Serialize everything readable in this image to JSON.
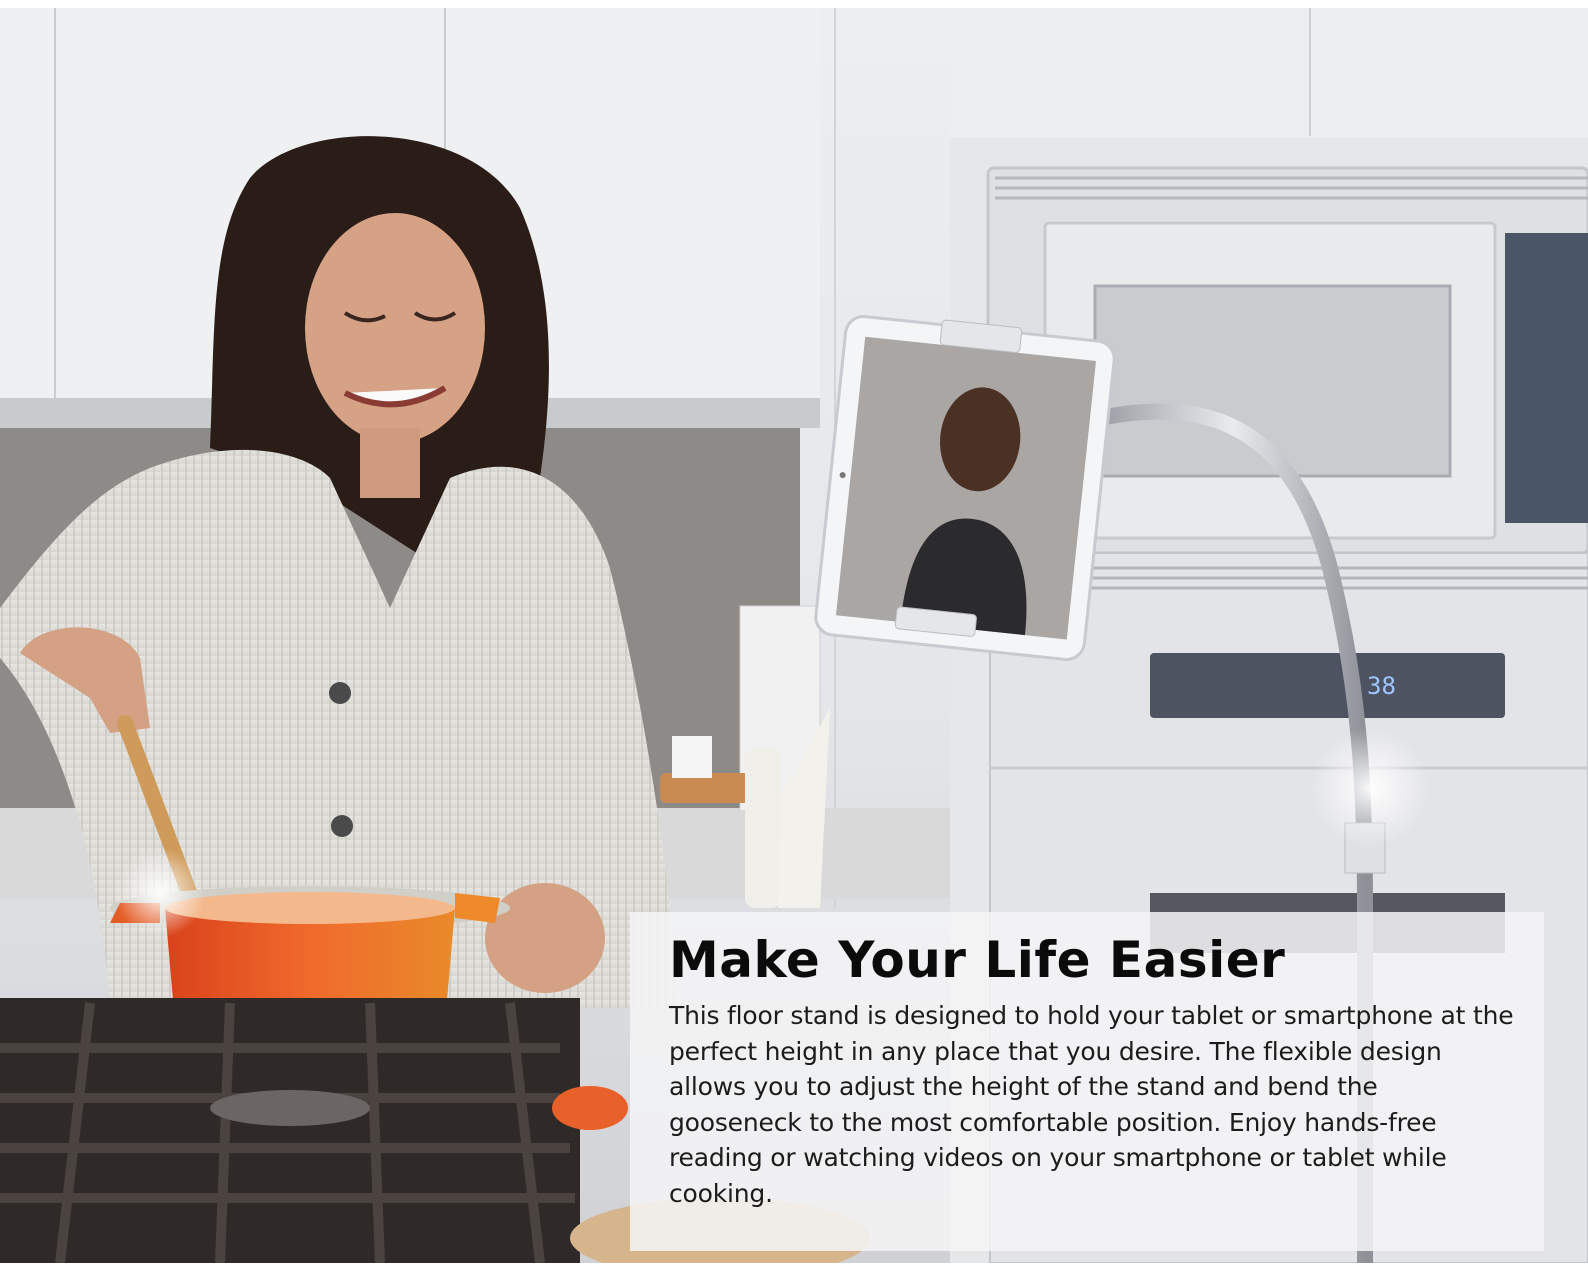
{
  "banner": {
    "headline": "Make Your Life Easier",
    "body": "This floor stand is designed to hold your tablet or smartphone at the perfect height in any place that you desire. The flexible design allows you to adjust the height of the stand and bend the gooseneck to the most comfortable position. Enjoy hands-free reading or watching videos on your smartphone or tablet while cooking."
  },
  "oven_display": "38",
  "colors": {
    "pot": "#e8602a",
    "panel": "#f4f4f6",
    "headline": "#0b0b0b"
  }
}
